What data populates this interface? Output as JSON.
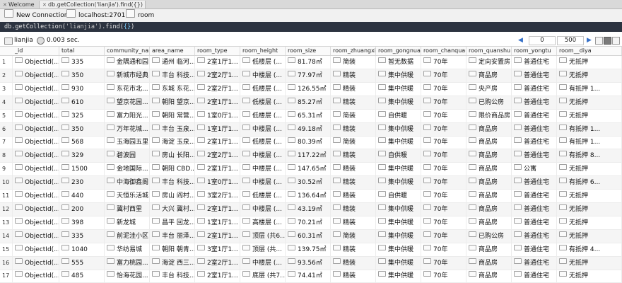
{
  "tabs": [
    {
      "label": "Welcome"
    },
    {
      "label": "db.getCollection('lianjia').find({})"
    }
  ],
  "toolbar": {
    "new_connection": "New Connection",
    "host": "localhost:27017",
    "db": "room"
  },
  "query_parts": {
    "prefix": "db.getCollection(",
    "collection": "'lianjia'",
    "mid": ").find(",
    "filter": "{}",
    "suffix": ")"
  },
  "status": {
    "collection": "lianjia",
    "time": "0.003 sec.",
    "skip": "0",
    "limit": "500",
    "prev": "◀",
    "next": "▶"
  },
  "columns": [
    "_id",
    "total",
    "community_name",
    "area_name",
    "room_type",
    "room_height",
    "room_size",
    "room_zhuangxiu",
    "room_gongnuan",
    "room_chanquan",
    "room_quanshu",
    "room_yongtu",
    "room__diya"
  ],
  "rows": [
    [
      "ObjectId(...",
      "335",
      "金隅通和园",
      "通州 临河...",
      "2室1厅1...",
      "低楼层 (...",
      "81.78㎡",
      "简装",
      "暂无数据",
      "70年",
      "定向安置房",
      "普通住宅",
      "无抵押"
    ],
    [
      "ObjectId(...",
      "350",
      "新城市经典",
      "丰台 科技...",
      "2室2厅1...",
      "中楼层 (...",
      "77.97㎡",
      "精装",
      "集中供暖",
      "70年",
      "商品房",
      "普通住宅",
      "无抵押"
    ],
    [
      "ObjectId(...",
      "930",
      "东花市北...",
      "东城 东花...",
      "2室2厅1...",
      "低楼层 (...",
      "126.55㎡",
      "精装",
      "集中供暖",
      "70年",
      "央产房",
      "普通住宅",
      "有抵押 1..."
    ],
    [
      "ObjectId(...",
      "610",
      "望京花园...",
      "朝阳 望京...",
      "2室1厅1...",
      "低楼层 (...",
      "85.27㎡",
      "精装",
      "集中供暖",
      "70年",
      "已购公房",
      "普通住宅",
      "无抵押"
    ],
    [
      "ObjectId(...",
      "325",
      "富力阳光...",
      "朝阳 常营...",
      "1室0厅1...",
      "低楼层 (...",
      "65.31㎡",
      "简装",
      "自供暖",
      "70年",
      "限价商品房",
      "普通住宅",
      "无抵押"
    ],
    [
      "ObjectId(...",
      "350",
      "万年花城...",
      "丰台 玉泉...",
      "1室1厅1...",
      "中楼层 (...",
      "49.18㎡",
      "精装",
      "集中供暖",
      "70年",
      "商品房",
      "普通住宅",
      "有抵押 1..."
    ],
    [
      "ObjectId(...",
      "568",
      "玉海园五里",
      "海淀 玉泉...",
      "2室1厅1...",
      "低楼层 (...",
      "80.39㎡",
      "简装",
      "集中供暖",
      "70年",
      "商品房",
      "普通住宅",
      "有抵押 1..."
    ],
    [
      "ObjectId(...",
      "329",
      "碧波园",
      "房山 长阳...",
      "2室2厅1...",
      "中楼层 (...",
      "117.22㎡",
      "精装",
      "自供暖",
      "70年",
      "商品房",
      "普通住宅",
      "有抵押 8..."
    ],
    [
      "ObjectId(...",
      "1500",
      "金地国际...",
      "朝阳 CBD...",
      "2室1厅1...",
      "中楼层 (...",
      "147.65㎡",
      "精装",
      "集中供暖",
      "70年",
      "商品房",
      "公寓",
      "无抵押"
    ],
    [
      "ObjectId(...",
      "230",
      "中海御鑫阁",
      "丰台 科技...",
      "1室0厅1...",
      "中楼层 (...",
      "30.52㎡",
      "精装",
      "集中供暖",
      "70年",
      "商品房",
      "普通住宅",
      "有抵押 6..."
    ],
    [
      "ObjectId(...",
      "440",
      "天恒乐活城",
      "房山 阎村...",
      "3室2厅1...",
      "低楼层 (...",
      "136.64㎡",
      "精装",
      "自供暖",
      "70年",
      "商品房",
      "普通住宅",
      "无抵押"
    ],
    [
      "ObjectId(...",
      "200",
      "冀村西里",
      "大兴 冀村...",
      "2室1厅1...",
      "中楼层 (...",
      "43.19㎡",
      "精装",
      "集中供暖",
      "70年",
      "商品房",
      "普通住宅",
      "无抵押"
    ],
    [
      "ObjectId(...",
      "398",
      "新龙城",
      "昌平 回龙...",
      "1室1厅1...",
      "高楼层 (...",
      "70.21㎡",
      "精装",
      "集中供暖",
      "70年",
      "商品房",
      "普通住宅",
      "无抵押"
    ],
    [
      "ObjectId(...",
      "335",
      "前泥洼小区",
      "丰台 丽泽...",
      "2室1厅1...",
      "顶层 (共6...",
      "60.31㎡",
      "简装",
      "集中供暖",
      "70年",
      "已购公房",
      "普通住宅",
      "无抵押"
    ],
    [
      "ObjectId(...",
      "1040",
      "华纺易城",
      "朝阳 朝青...",
      "3室1厅1...",
      "顶层 (共...",
      "139.75㎡",
      "精装",
      "集中供暖",
      "70年",
      "商品房",
      "普通住宅",
      "有抵押 4..."
    ],
    [
      "ObjectId(...",
      "555",
      "富力桃园...",
      "海淀 西三...",
      "2室2厅1...",
      "中楼层 (...",
      "93.56㎡",
      "精装",
      "集中供暖",
      "70年",
      "商品房",
      "普通住宅",
      "无抵押"
    ],
    [
      "ObjectId(...",
      "485",
      "怡海花园...",
      "丰台 科技...",
      "2室1厅1...",
      "底层 (共7...",
      "74.41㎡",
      "精装",
      "集中供暖",
      "70年",
      "商品房",
      "普通住宅",
      "无抵押"
    ]
  ]
}
